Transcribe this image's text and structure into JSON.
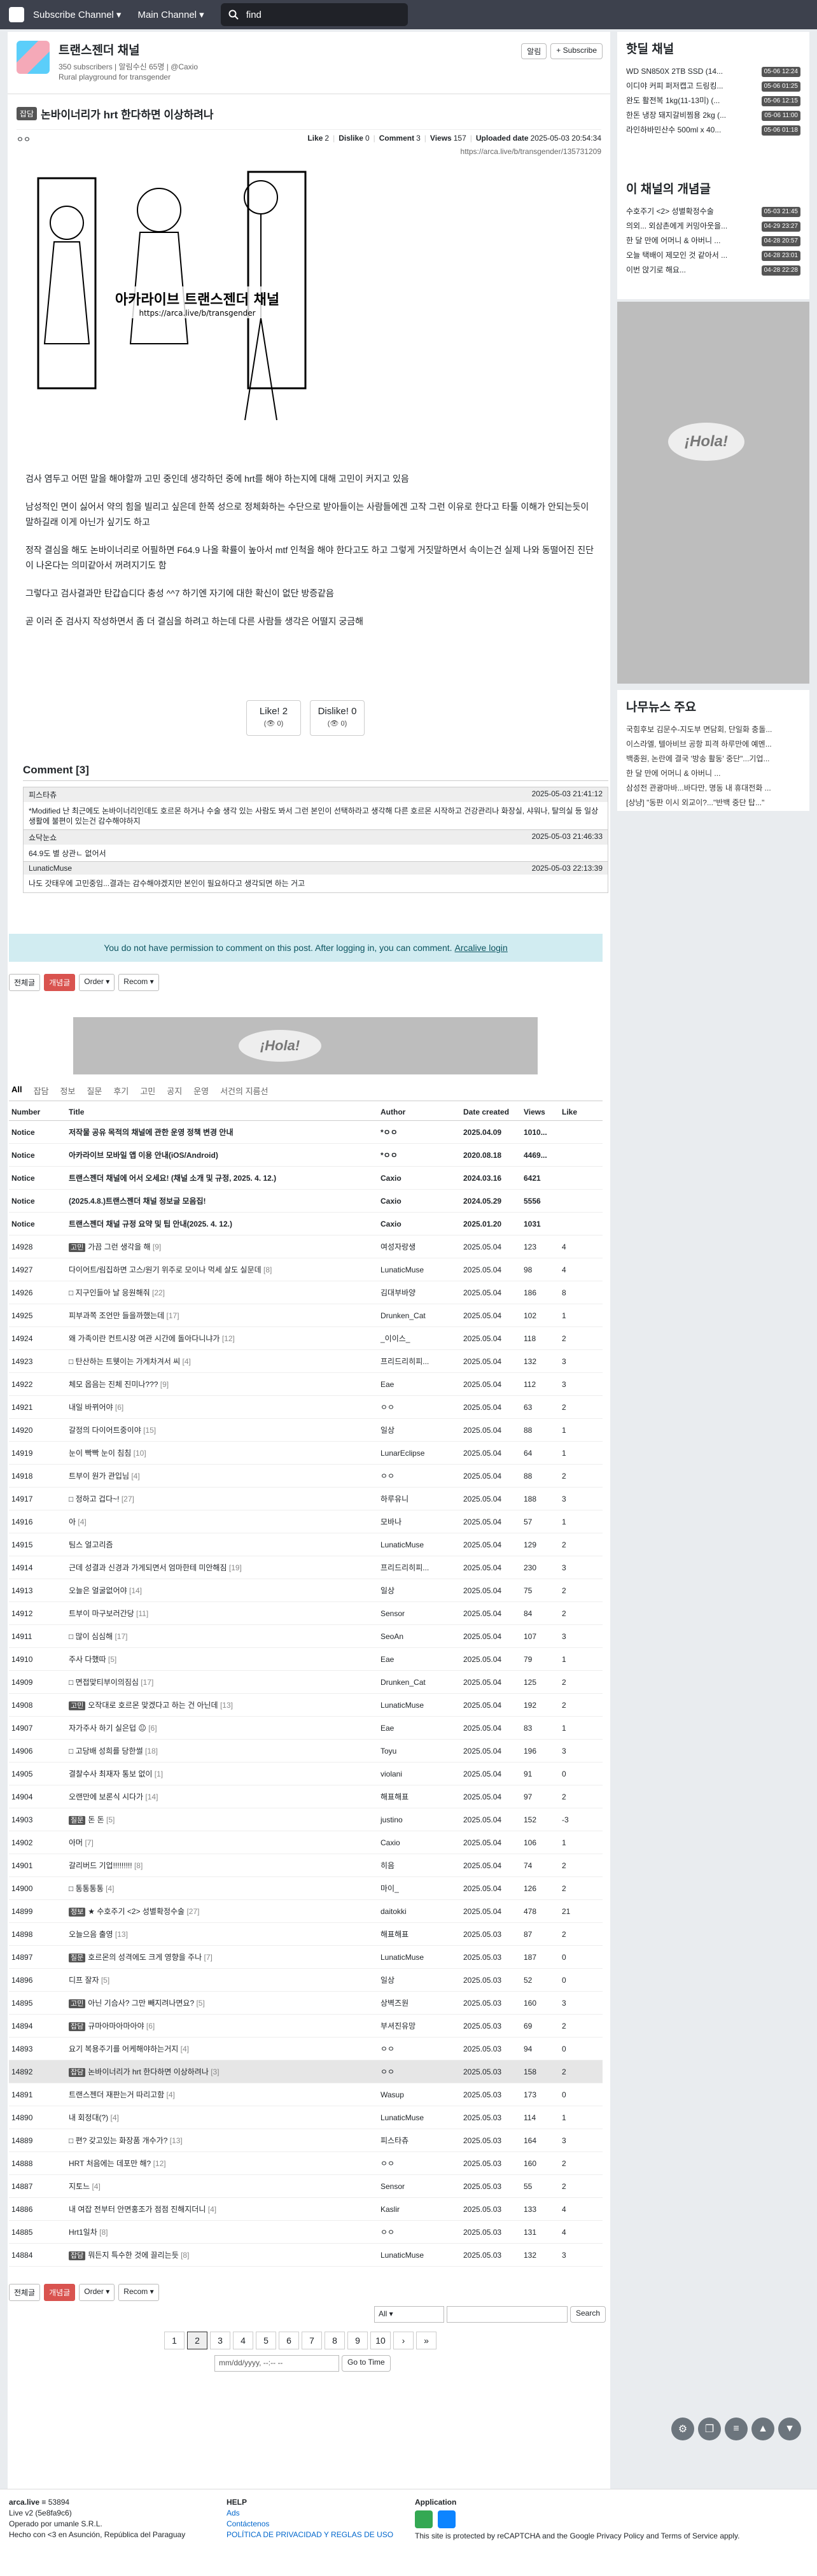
{
  "topbar": {
    "subscribe": "Subscribe Channel ▾",
    "main": "Main Channel ▾",
    "search_placeholder": "find"
  },
  "channel": {
    "name": "트랜스젠더 채널",
    "stats": "350 subscribers | 알림수신 65명 | @Caxio",
    "desc": "Rural playground for transgender",
    "alert_btn": "알림",
    "subscribe_btn": "+ Subscribe"
  },
  "article": {
    "badge": "잡담",
    "title": "논바이너리가 hrt 한다하면 이상하려나",
    "author": "ㅇㅇ",
    "like_label": "Like",
    "like": "2",
    "dislike_label": "Dislike",
    "dislike": "0",
    "comment_label": "Comment",
    "comment": "3",
    "views_label": "Views",
    "views": "157",
    "uploaded_label": "Uploaded date",
    "uploaded": "2025-05-03 20:54:34",
    "url": "https://arca.live/b/transgender/135731209",
    "img_caption": "아카라이브 트랜스젠더 채널",
    "img_url": "https://arca.live/b/transgender",
    "paragraphs": [
      "검사 염두고 어떤 말을 해야할까 고민 중인데 생각하던 중에 hrt를 해야 하는지에 대해 고민이 커지고 있음",
      "남성적인 면이 싫어서 약의 힘을 빌리고 싶은데 한쪽 성으로 정체화하는 수단으로 받아들이는 사람들에겐 고작 그런 이유로 한다고 타툴 이해가 안되는듯이 말하길래 이게 아닌가 싶기도 하고",
      "정작 결심을 해도 논바이너리로 어필하면 F64.9 나올 확률이 높아서 mtf 인척을 해야 한다고도 하고 그렇게 거짓말하면서 속이는건 실제 나와 동떨어진 진단이 나온다는 의미같아서 꺼려지기도 함",
      "그렇다고 검사결과만 탄갑습디다 충성 ^^7 하기엔 자기에 대한 확신이 없단 방증같음",
      "곧 이러 준 검사지 작성하면서 좀 더 결심을 하려고 하는데 다른 사람들 생각은 어떨지 궁금해"
    ],
    "vote_like": "Like! 2",
    "vote_like_sub": "(👁 0)",
    "vote_dislike": "Dislike! 0",
    "vote_dislike_sub": "(👁 0)"
  },
  "comments": {
    "title": "Comment [3]",
    "items": [
      {
        "author": "피스타츄",
        "time": "2025-05-03 21:41:12",
        "text": "*Modified 난 최근에도 논바이너리인데도 호르몬 하거나 수술 생각 있는 사람도 봐서 그런 본인이 선택하라고 생각해 다른 호르몬 시작하고 건강관리나 화장실, 샤워나, 탈의실 등 일상생활에 불편이 있는건 감수해야하지"
      },
      {
        "author": "쇼닥눈쇼",
        "time": "2025-05-03 21:46:33",
        "text": "64.9도 별 상관ㄴ 없어서"
      },
      {
        "author": "LunaticMuse",
        "time": "2025-05-03 22:13:39",
        "text": "나도 갓태우에 고민중임...결과는 감수해야겠지만 본인이 필요하다고 생각되면 하는 거고"
      }
    ]
  },
  "permission": {
    "text": "You do not have permission to comment on this post. After logging in, you can comment.",
    "link": "Arcalive login"
  },
  "filters": {
    "all": "전체글",
    "best": "개념글",
    "order": "Order ▾",
    "recom": "Recom ▾"
  },
  "ad": {
    "hola": "¡Hola!"
  },
  "categories": [
    "All",
    "잡담",
    "정보",
    "질문",
    "후기",
    "고민",
    "공지",
    "운영",
    "서건의 지름선"
  ],
  "table": {
    "headers": [
      "Number",
      "Title",
      "Author",
      "Date created",
      "Views",
      "Like"
    ],
    "rows": [
      {
        "n": "Notice",
        "tag": "",
        "title": "저작물 공유 목적의 채널에 관한 운영 정책 변경 안내",
        "author": "*ㅇㅇ",
        "date": "2025.04.09",
        "views": "1010...",
        "like": "",
        "notice": true
      },
      {
        "n": "Notice",
        "tag": "",
        "title": "아카라이브 모바일 앱 이용 안내(iOS/Android)",
        "author": "*ㅇㅇ",
        "date": "2020.08.18",
        "views": "4469...",
        "like": "",
        "notice": true
      },
      {
        "n": "Notice",
        "tag": "",
        "title": "트랜스젠더 채널에 어서 오세요! (채널 소개 및 규정, 2025. 4. 12.)",
        "author": "Caxio",
        "date": "2024.03.16",
        "views": "6421",
        "like": "",
        "notice": true
      },
      {
        "n": "Notice",
        "tag": "",
        "title": "(2025.4.8.)트랜스젠더 채널 정보글 모음집!",
        "author": "Caxio",
        "date": "2024.05.29",
        "views": "5556",
        "like": "",
        "notice": true
      },
      {
        "n": "Notice",
        "tag": "",
        "title": "트랜스젠더 채널 규정 요약 및 팁 안내(2025. 4. 12.)",
        "author": "Caxio",
        "date": "2025.01.20",
        "views": "1031",
        "like": "",
        "notice": true
      },
      {
        "n": "14928",
        "tag": "고민",
        "title": "가끔 그런 생각을 해",
        "cc": "[9]",
        "author": "여성자랑생",
        "date": "2025.05.04",
        "views": "123",
        "like": "4"
      },
      {
        "n": "14927",
        "tag": "",
        "title": "다이어트/림집하면 고스/원기 위주로 모이나 먹세 살도 실문데",
        "cc": "[8]",
        "author": "LunaticMuse",
        "date": "2025.05.04",
        "views": "98",
        "like": "4"
      },
      {
        "n": "14926",
        "tag": "",
        "title": "□ 지구인들아 날 응원해줘",
        "cc": "[22]",
        "author": "김대부바양",
        "date": "2025.05.04",
        "views": "186",
        "like": "8"
      },
      {
        "n": "14925",
        "tag": "",
        "title": "피부과쪽 조언만 들을까했는데",
        "cc": "[17]",
        "author": "Drunken_Cat",
        "date": "2025.05.04",
        "views": "102",
        "like": "1"
      },
      {
        "n": "14924",
        "tag": "",
        "title": "왜 가족이란 컨트시장 여관 시간에 돌아다니냐가",
        "cc": "[12]",
        "author": "_이이스_",
        "date": "2025.05.04",
        "views": "118",
        "like": "2"
      },
      {
        "n": "14923",
        "tag": "",
        "title": "□ 탄산하는 트웻이는 가게차겨서 씨",
        "cc": "[4]",
        "author": "프리드리히피...",
        "date": "2025.05.04",
        "views": "132",
        "like": "3"
      },
      {
        "n": "14922",
        "tag": "",
        "title": "체모 옵음는 진체 진미나???",
        "cc": "[9]",
        "author": "Eae",
        "date": "2025.05.04",
        "views": "112",
        "like": "3"
      },
      {
        "n": "14921",
        "tag": "",
        "title": "내일 바뀌어야",
        "cc": "[6]",
        "author": "ㅇㅇ",
        "date": "2025.05.04",
        "views": "63",
        "like": "2"
      },
      {
        "n": "14920",
        "tag": "",
        "title": "갈정의 다이어트중이야",
        "cc": "[15]",
        "author": "일상",
        "date": "2025.05.04",
        "views": "88",
        "like": "1"
      },
      {
        "n": "14919",
        "tag": "",
        "title": "눈이 빡빡 눈이 침침",
        "cc": "[10]",
        "author": "LunarEclipse",
        "date": "2025.05.04",
        "views": "64",
        "like": "1"
      },
      {
        "n": "14918",
        "tag": "",
        "title": "트부이 원가 관입님",
        "cc": "[4]",
        "author": "ㅇㅇ",
        "date": "2025.05.04",
        "views": "88",
        "like": "2"
      },
      {
        "n": "14917",
        "tag": "",
        "title": "□ 정하고 겁다~!",
        "cc": "[27]",
        "author": "하루유니",
        "date": "2025.05.04",
        "views": "188",
        "like": "3"
      },
      {
        "n": "14916",
        "tag": "",
        "title": "아",
        "cc": "[4]",
        "author": "모바나",
        "date": "2025.05.04",
        "views": "57",
        "like": "1"
      },
      {
        "n": "14915",
        "tag": "",
        "title": "팀스 얼고리즘",
        "cc": "",
        "author": "LunaticMuse",
        "date": "2025.05.04",
        "views": "129",
        "like": "2"
      },
      {
        "n": "14914",
        "tag": "",
        "title": "근데 성결과 신경과 가게되면서 엄마한테 미안해짐",
        "cc": "[19]",
        "author": "프리드리히피...",
        "date": "2025.05.04",
        "views": "230",
        "like": "3"
      },
      {
        "n": "14913",
        "tag": "",
        "title": "오늘은 얼굴없어야",
        "cc": "[14]",
        "author": "일상",
        "date": "2025.05.04",
        "views": "75",
        "like": "2"
      },
      {
        "n": "14912",
        "tag": "",
        "title": "트부이 마구보러간당",
        "cc": "[11]",
        "author": "Sensor",
        "date": "2025.05.04",
        "views": "84",
        "like": "2"
      },
      {
        "n": "14911",
        "tag": "",
        "title": "□ 많이 심심해",
        "cc": "[17]",
        "author": "SeoAn",
        "date": "2025.05.04",
        "views": "107",
        "like": "3"
      },
      {
        "n": "14910",
        "tag": "",
        "title": "주사 다했따",
        "cc": "[5]",
        "author": "Eae",
        "date": "2025.05.04",
        "views": "79",
        "like": "1"
      },
      {
        "n": "14909",
        "tag": "",
        "title": "□ 면접맞티부이의짐심",
        "cc": "[17]",
        "author": "Drunken_Cat",
        "date": "2025.05.04",
        "views": "125",
        "like": "2"
      },
      {
        "n": "14908",
        "tag": "고민",
        "title": "오작대로 호르몬 맞겠다고 하는 건 아닌데",
        "cc": "[13]",
        "author": "LunaticMuse",
        "date": "2025.05.04",
        "views": "192",
        "like": "2"
      },
      {
        "n": "14907",
        "tag": "",
        "title": "자가주사 하기 실은덥 😐",
        "cc": "[6]",
        "author": "Eae",
        "date": "2025.05.04",
        "views": "83",
        "like": "1"
      },
      {
        "n": "14906",
        "tag": "",
        "title": "□ 고당배 성희를 당한썰",
        "cc": "[18]",
        "author": "Toyu",
        "date": "2025.05.04",
        "views": "196",
        "like": "3"
      },
      {
        "n": "14905",
        "tag": "",
        "title": "결찰수사 최재자 통보 없이",
        "cc": "[1]",
        "author": "violani",
        "date": "2025.05.04",
        "views": "91",
        "like": "0"
      },
      {
        "n": "14904",
        "tag": "",
        "title": "오랜만에 보론식 시다가",
        "cc": "[14]",
        "author": "해표해표",
        "date": "2025.05.04",
        "views": "97",
        "like": "2"
      },
      {
        "n": "14903",
        "tag": "질문",
        "title": "돈 돈",
        "cc": "[5]",
        "author": "justino",
        "date": "2025.05.04",
        "views": "152",
        "like": "-3"
      },
      {
        "n": "14902",
        "tag": "",
        "title": "아머",
        "cc": "[7]",
        "author": "Caxio",
        "date": "2025.05.04",
        "views": "106",
        "like": "1"
      },
      {
        "n": "14901",
        "tag": "",
        "title": "갈리버드 기업!!!!!!!!!",
        "cc": "[8]",
        "author": "히음",
        "date": "2025.05.04",
        "views": "74",
        "like": "2"
      },
      {
        "n": "14900",
        "tag": "",
        "title": "□ 통통통통",
        "cc": "[4]",
        "author": "마이_",
        "date": "2025.05.04",
        "views": "126",
        "like": "2"
      },
      {
        "n": "14899",
        "tag": "정보",
        "title": "★ 수호주기 <2> 성별확정수술",
        "cc": "[27]",
        "author": "daitokki",
        "date": "2025.05.04",
        "views": "478",
        "like": "21"
      },
      {
        "n": "14898",
        "tag": "",
        "title": "오늘으음 출영",
        "cc": "[13]",
        "author": "해표해표",
        "date": "2025.05.03",
        "views": "87",
        "like": "2"
      },
      {
        "n": "14897",
        "tag": "질문",
        "title": "호르몬의 성격에도 크게 영향을 주나",
        "cc": "[7]",
        "author": "LunaticMuse",
        "date": "2025.05.03",
        "views": "187",
        "like": "0"
      },
      {
        "n": "14896",
        "tag": "",
        "title": "디프 잘자",
        "cc": "[5]",
        "author": "일상",
        "date": "2025.05.03",
        "views": "52",
        "like": "0"
      },
      {
        "n": "14895",
        "tag": "고민",
        "title": "아닌 기슴사? 그만 빼지려나면요?",
        "cc": "[5]",
        "author": "상벽즈원",
        "date": "2025.05.03",
        "views": "160",
        "like": "3"
      },
      {
        "n": "14894",
        "tag": "잡담",
        "title": "규마아마아마아야",
        "cc": "[6]",
        "author": "부셔진유망",
        "date": "2025.05.03",
        "views": "69",
        "like": "2"
      },
      {
        "n": "14893",
        "tag": "",
        "title": "요기 복용주기를 어케해야하는거지",
        "cc": "[4]",
        "author": "ㅇㅇ",
        "date": "2025.05.03",
        "views": "94",
        "like": "0"
      },
      {
        "n": "14892",
        "tag": "잡담",
        "title": "논바이너리가 hrt 한다하면 이상하려나",
        "cc": "[3]",
        "author": "ㅇㅇ",
        "date": "2025.05.03",
        "views": "158",
        "like": "2",
        "curr": true
      },
      {
        "n": "14891",
        "tag": "",
        "title": "트랜스젠더 재판는거 따리고함",
        "cc": "[4]",
        "author": "Wasup",
        "date": "2025.05.03",
        "views": "173",
        "like": "0"
      },
      {
        "n": "14890",
        "tag": "",
        "title": "내 회정대(?)",
        "cc": "[4]",
        "author": "LunaticMuse",
        "date": "2025.05.03",
        "views": "114",
        "like": "1"
      },
      {
        "n": "14889",
        "tag": "",
        "title": "□ 편? 갖고있는 화장품 개수가?",
        "cc": "[13]",
        "author": "피스타츄",
        "date": "2025.05.03",
        "views": "164",
        "like": "3"
      },
      {
        "n": "14888",
        "tag": "",
        "title": "HRT 처음에는 데포만 해?",
        "cc": "[12]",
        "author": "ㅇㅇ",
        "date": "2025.05.03",
        "views": "160",
        "like": "2"
      },
      {
        "n": "14887",
        "tag": "",
        "title": "지토느",
        "cc": "[4]",
        "author": "Sensor",
        "date": "2025.05.03",
        "views": "55",
        "like": "2"
      },
      {
        "n": "14886",
        "tag": "",
        "title": "내 여잡 전부터 안면홍조가 점점 진해지더니",
        "cc": "[4]",
        "author": "Kaslir",
        "date": "2025.05.03",
        "views": "133",
        "like": "4"
      },
      {
        "n": "14885",
        "tag": "",
        "title": "Hrt1일차",
        "cc": "[8]",
        "author": "ㅇㅇ",
        "date": "2025.05.03",
        "views": "131",
        "like": "4"
      },
      {
        "n": "14884",
        "tag": "잡담",
        "title": "뭐든지 특수한 것에 끌리는듯",
        "cc": "[8]",
        "author": "LunaticMuse",
        "date": "2025.05.03",
        "views": "132",
        "like": "3"
      }
    ]
  },
  "pager": {
    "pages": [
      "1",
      "2",
      "3",
      "4",
      "5",
      "6",
      "7",
      "8",
      "9",
      "10"
    ],
    "current": "2",
    "next": "›",
    "last": "»"
  },
  "board_search": {
    "select": "All ▾",
    "button": "Search",
    "date_placeholder": "mm/dd/yyyy, --:-- --",
    "goto": "Go to Time"
  },
  "sidebar": {
    "hot": {
      "title": "핫딜 채널",
      "items": [
        {
          "t": "WD SN850X 2TB SSD (14...",
          "time": "05-06 12:24"
        },
        {
          "t": "이디야 커피 퍼저캡고 드링킹...",
          "time": "05-06 01:25"
        },
        {
          "t": "완도 활전복 1kg(11-13미) (...",
          "time": "05-06 12:15"
        },
        {
          "t": "한돈 냉장 돼지갈비찜용 2kg (...",
          "time": "05-06 11:00"
        },
        {
          "t": "라인하바민산수 500ml x 40...",
          "time": "05-06 01:18"
        }
      ]
    },
    "best": {
      "title": "이 채널의 개념글",
      "items": [
        {
          "t": "수호주기 <2> 성별확정수술",
          "time": "05-03 21:45"
        },
        {
          "t": "의외... 외삼촌에게 커밍아웃을...",
          "time": "04-29 23:27"
        },
        {
          "t": "한 달 만에 어머니 & 아버니 ...",
          "time": "04-28 20:57"
        },
        {
          "t": "오늘 택배이 제모인 것 같아서 ...",
          "time": "04-28 23:01"
        },
        {
          "t": "이번 앉기로 해요...",
          "time": "04-28 22:28"
        }
      ]
    },
    "ad_hola": "¡Hola!",
    "news": {
      "title": "나무뉴스 주요",
      "items": [
        "국힘후보 김문수-지도부 면담회, 단일화 충돌...",
        "이스라엘, 텔아비브 공항 피격 하루만에 예멘...",
        "백종원, 논란에 결국 '방송 활동' 중단\"...기업...",
        "한 달 만에 어머니 & 아버니 ...",
        "삼성전 관광마바...바다만, 명동 내 휴대전화 ...",
        "[상냥] \"동판 이시 외교이?...\"반백 중단 탑...\""
      ]
    }
  },
  "footer": {
    "site": "arca.live",
    "count": "≡ 53894",
    "ver": "Live v2 (5e8fa9c6)",
    "operated": "Operado por umanle S.R.L.",
    "made": "Hecho con <3 en Asunción, República del Paraguay",
    "help": "HELP",
    "help_items": [
      "Ads",
      "Contáctenos",
      "POLÍTICA DE PRIVACIDAD Y REGLAS DE USO"
    ],
    "app": "Application",
    "recaptcha": "This site is protected by reCAPTCHA and the Google Privacy Policy and Terms of Service apply."
  }
}
